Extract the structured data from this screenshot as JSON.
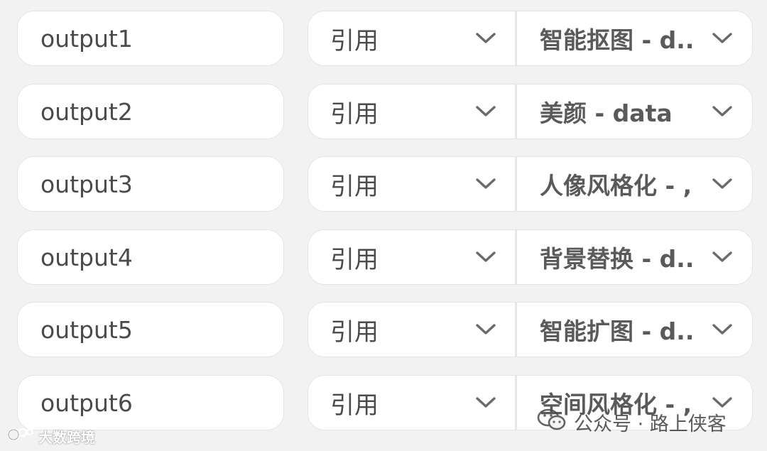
{
  "rows": [
    {
      "name": "output1",
      "type": "引用",
      "source": "智能抠图 - d.."
    },
    {
      "name": "output2",
      "type": "引用",
      "source": "美颜 - data"
    },
    {
      "name": "output3",
      "type": "引用",
      "source": "人像风格化 - ,"
    },
    {
      "name": "output4",
      "type": "引用",
      "source": "背景替换 - d.."
    },
    {
      "name": "output5",
      "type": "引用",
      "source": "智能扩图 - d.."
    },
    {
      "name": "output6",
      "type": "引用",
      "source": "空间风格化 - ,"
    }
  ],
  "watermarks": {
    "left_text": "大数跨境",
    "right_text": "公众号 · 路上侠客"
  },
  "icons": {
    "dropdown": "chevron-down-icon",
    "left_watermark_logo": "logo-icon",
    "right_watermark_logo": "wechat-icon"
  }
}
